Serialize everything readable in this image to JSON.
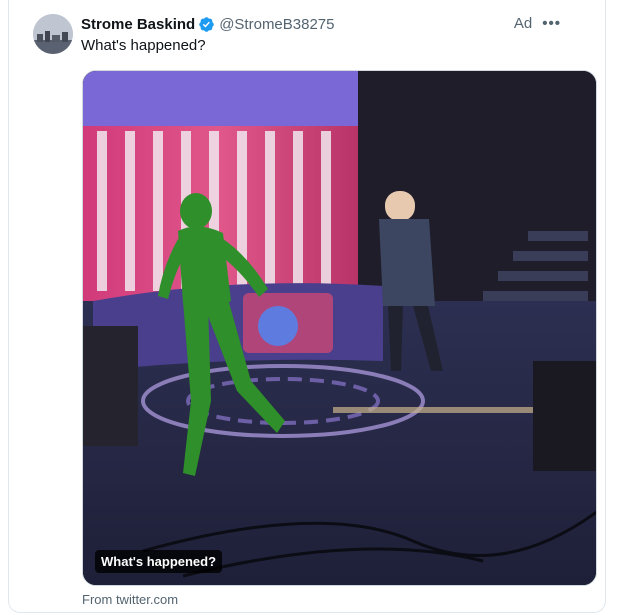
{
  "post": {
    "display_name": "Strome Baskind",
    "handle": "@StromeB38275",
    "ad_label": "Ad",
    "more_icon": "more-horizontal-icon",
    "text": "What's happened?"
  },
  "media": {
    "caption": "What's happened?",
    "source": "From twitter.com"
  },
  "colors": {
    "verified": "#1d9bf0",
    "secondary_text": "#536471",
    "primary_text": "#0f1419"
  }
}
